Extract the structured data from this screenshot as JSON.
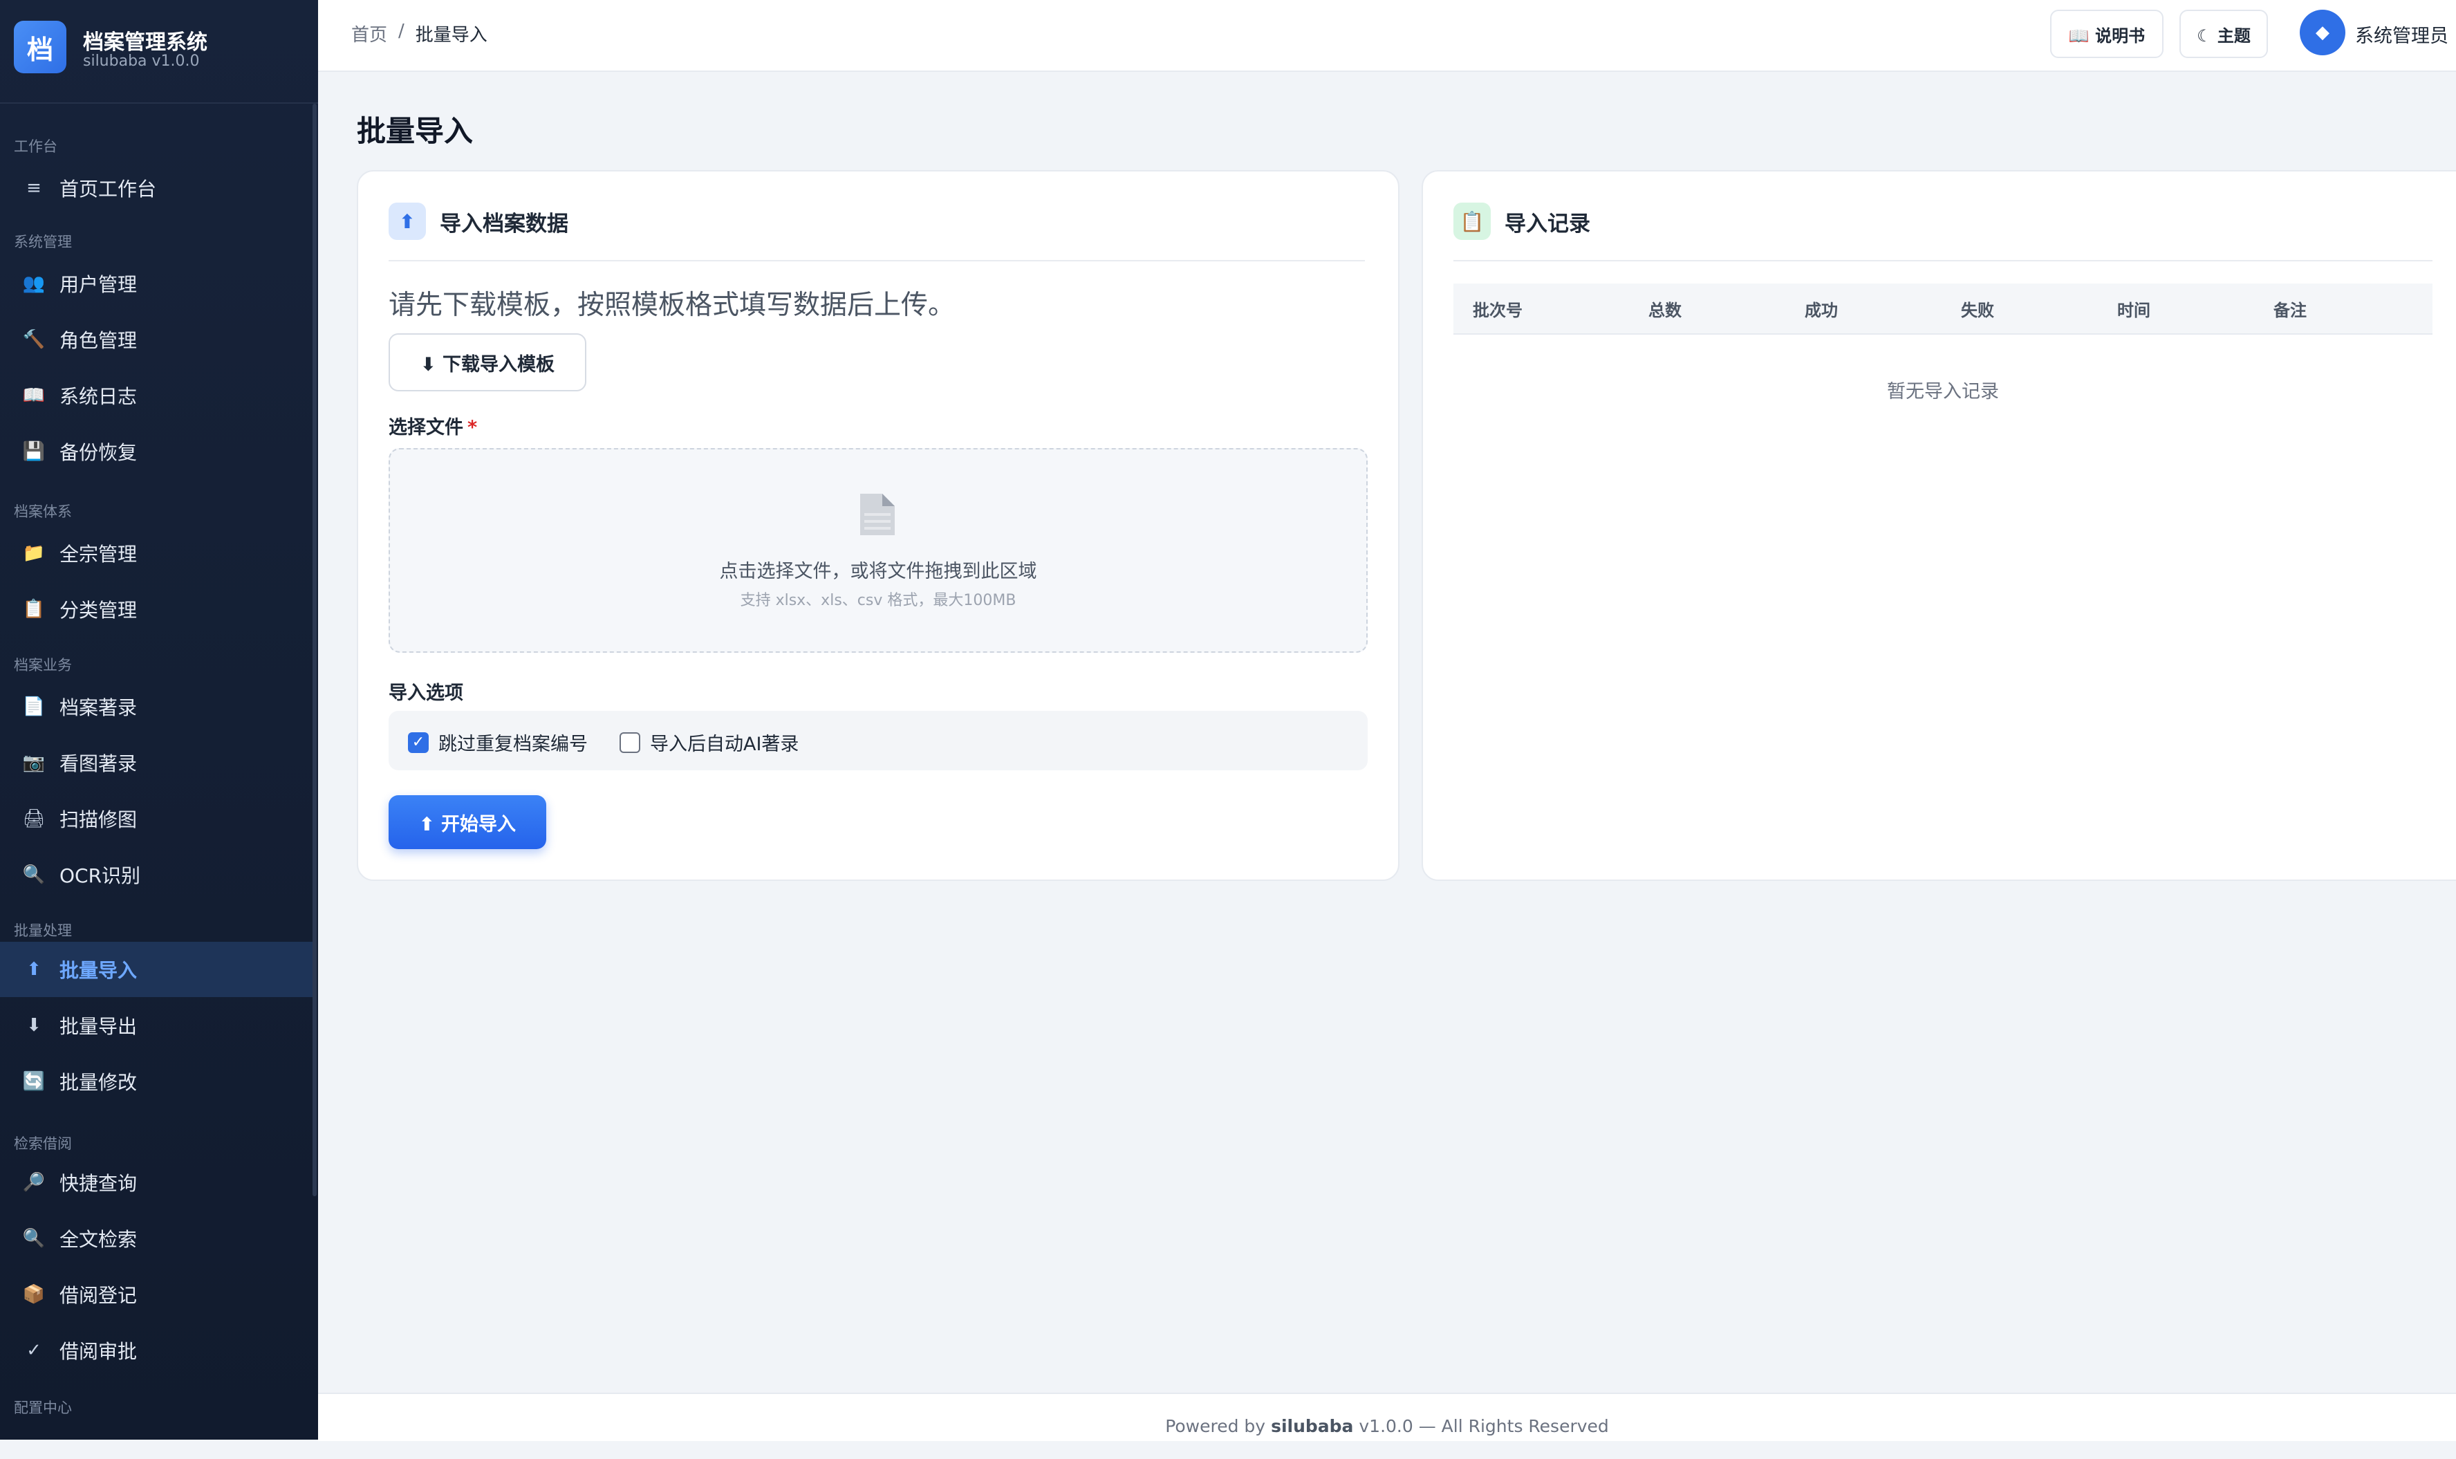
{
  "app": {
    "logo_char": "档",
    "name": "档案管理系统",
    "version": "silubaba v1.0.0"
  },
  "sidebar": {
    "sections": [
      {
        "label": "工作台",
        "items": [
          {
            "icon": "≡",
            "icon_name": "menu-icon",
            "label": "首页工作台"
          }
        ]
      },
      {
        "label": "系统管理",
        "items": [
          {
            "icon": "👥",
            "icon_name": "users-icon",
            "label": "用户管理"
          },
          {
            "icon": "🔨",
            "icon_name": "hammer-icon",
            "label": "角色管理"
          },
          {
            "icon": "📖",
            "icon_name": "book-icon",
            "label": "系统日志"
          },
          {
            "icon": "💾",
            "icon_name": "floppy-disk-icon",
            "label": "备份恢复"
          }
        ]
      },
      {
        "label": "档案体系",
        "items": [
          {
            "icon": "📁",
            "icon_name": "folder-icon",
            "label": "全宗管理"
          },
          {
            "icon": "📋",
            "icon_name": "clipboard-icon",
            "label": "分类管理"
          }
        ]
      },
      {
        "label": "档案业务",
        "items": [
          {
            "icon": "📄",
            "icon_name": "document-icon",
            "label": "档案著录"
          },
          {
            "icon": "📷",
            "icon_name": "camera-icon",
            "label": "看图著录"
          },
          {
            "icon": "🖨",
            "icon_name": "printer-icon",
            "label": "扫描修图"
          },
          {
            "icon": "🔍",
            "icon_name": "magnifier-icon",
            "label": "OCR识别"
          }
        ]
      },
      {
        "label": "批量处理",
        "items": [
          {
            "icon": "⬆",
            "icon_name": "upload-arrow-icon",
            "label": "批量导入",
            "active": true
          },
          {
            "icon": "⬇",
            "icon_name": "download-arrow-icon",
            "label": "批量导出"
          },
          {
            "icon": "🔄",
            "icon_name": "refresh-icon",
            "label": "批量修改"
          }
        ]
      },
      {
        "label": "检索借阅",
        "items": [
          {
            "icon": "🔎",
            "icon_name": "quick-search-icon",
            "label": "快捷查询"
          },
          {
            "icon": "🔍",
            "icon_name": "fulltext-search-icon",
            "label": "全文检索"
          },
          {
            "icon": "📦",
            "icon_name": "package-icon",
            "label": "借阅登记"
          },
          {
            "icon": "✓",
            "icon_name": "check-icon",
            "label": "借阅审批"
          }
        ]
      },
      {
        "label": "配置中心",
        "items": []
      }
    ]
  },
  "topbar": {
    "breadcrumb": {
      "home": "首页",
      "separator": "/",
      "current": "批量导入"
    },
    "manual_label": "📖 说明书",
    "theme_label": "☾ 主题",
    "user_name": "系统管理员",
    "user_icon": "◆"
  },
  "page": {
    "title": "批量导入"
  },
  "import_card": {
    "icon": "⬆",
    "title": "导入档案数据",
    "lead": "请先下载模板，按照模板格式填写数据后上传。",
    "download_label": "⬇ 下载导入模板",
    "file_label": "选择文件",
    "required_mark": "*",
    "dropzone_text": "点击选择文件，或将文件拖拽到此区域",
    "dropzone_hint": "支持 xlsx、xls、csv 格式，最大100MB",
    "options_label": "导入选项",
    "option_skip_duplicates": {
      "label": "跳过重复档案编号",
      "checked": true
    },
    "option_auto_ai": {
      "label": "导入后自动AI著录",
      "checked": false
    },
    "start_label": "⬆ 开始导入"
  },
  "records_card": {
    "icon": "📋",
    "title": "导入记录",
    "columns": [
      "批次号",
      "总数",
      "成功",
      "失败",
      "时间",
      "备注"
    ],
    "rows": [],
    "empty_text": "暂无导入记录"
  },
  "footer": {
    "prefix": "Powered by ",
    "brand": "silubaba",
    "suffix": " v1.0.0 — All Rights Reserved"
  },
  "colors": {
    "sidebar_bg": "#17233a",
    "accent": "#2f6fe6",
    "active_text": "#6ea8ff",
    "required": "#dc2626"
  }
}
